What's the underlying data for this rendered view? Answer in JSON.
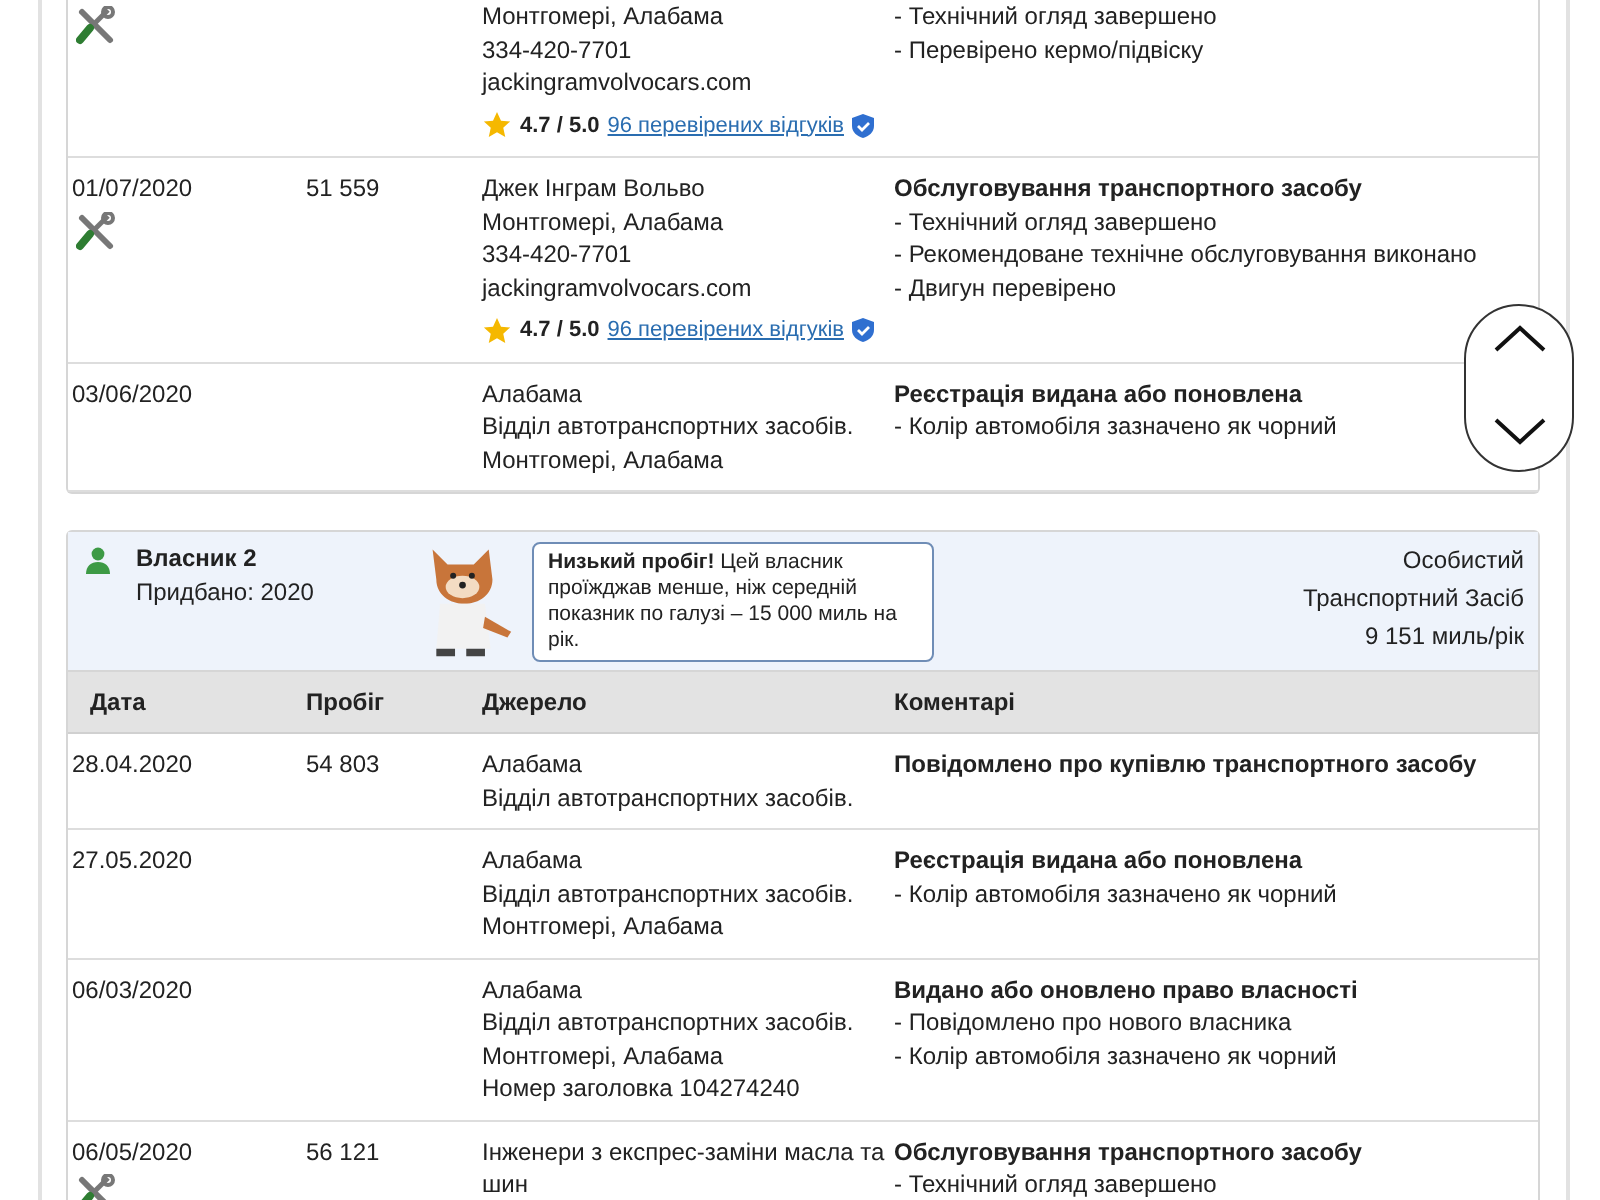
{
  "sections": [
    {
      "rows": [
        {
          "date": "",
          "mileage": "",
          "service": true,
          "source": [
            "Монтгомері, Алабама",
            "334-420-7701",
            "jackingramvolvocars.com"
          ],
          "rating": {
            "score": "4.7 / 5.0",
            "reviews": "96 перевірених відгуків",
            "verified": true
          },
          "comment_title": "",
          "comment_items": [
            "- Технічний огляд завершено",
            "- Перевірено кермо/підвіску"
          ]
        },
        {
          "date": "01/07/2020",
          "mileage": "51 559",
          "service": true,
          "source": [
            "Джек Інграм Вольво",
            "Монтгомері, Алабама",
            "334-420-7701",
            "jackingramvolvocars.com"
          ],
          "rating": {
            "score": "4.7 / 5.0",
            "reviews": "96 перевірених відгуків",
            "verified": true
          },
          "comment_title": "Обслуговування транспортного засобу",
          "comment_items": [
            "- Технічний огляд завершено",
            "- Рекомендоване технічне обслуговування виконано",
            "- Двигун перевірено"
          ]
        },
        {
          "date": "03/06/2020",
          "mileage": "",
          "service": false,
          "source": [
            "Алабама",
            "Відділ автотранспортних засобів.",
            "Монтгомері, Алабама"
          ],
          "comment_title": "Реєстрація видана або поновлена",
          "comment_items": [
            "- Колір автомобіля зазначено як чорний"
          ]
        }
      ]
    },
    {
      "owner": {
        "title": "Власник 2",
        "purchased": "Придбано: 2020",
        "tip": "**Низький пробіг!** Цей власник проїжджав менше, ніж середній показник по галузі – 15 000 миль на рік.",
        "usage": [
          "Особистий",
          "Транспортний Засіб",
          "9 151 миль/рік"
        ]
      },
      "columns": [
        "Дата",
        "Пробіг",
        "Джерело",
        "Коментарі"
      ],
      "rows": [
        {
          "date": "28.04.2020",
          "mileage": "54 803",
          "service": false,
          "source": [
            "Алабама",
            "Відділ автотранспортних засобів."
          ],
          "comment_title": "Повідомлено про купівлю транспортного засобу",
          "comment_items": []
        },
        {
          "date": "27.05.2020",
          "mileage": "",
          "service": false,
          "source": [
            "Алабама",
            "Відділ автотранспортних засобів.",
            "Монтгомері, Алабама"
          ],
          "comment_title": "Реєстрація видана або поновлена",
          "comment_items": [
            "- Колір автомобіля зазначено як чорний"
          ]
        },
        {
          "date": "06/03/2020",
          "mileage": "",
          "service": false,
          "source": [
            "Алабама",
            "Відділ автотранспортних засобів.",
            "Монтгомері, Алабама",
            "Номер заголовка 104274240"
          ],
          "comment_title": "Видано або оновлено право власності",
          "comment_items": [
            "- Повідомлено про нового власника",
            "- Колір автомобіля зазначено як чорний"
          ]
        },
        {
          "date": "06/05/2020",
          "mileage": "56 121",
          "service": true,
          "source": [
            "Інженери з експрес-заміни масла та шин"
          ],
          "comment_title": "Обслуговування транспортного засобу",
          "comment_items": [
            "- Технічний огляд завершено"
          ]
        }
      ]
    }
  ]
}
